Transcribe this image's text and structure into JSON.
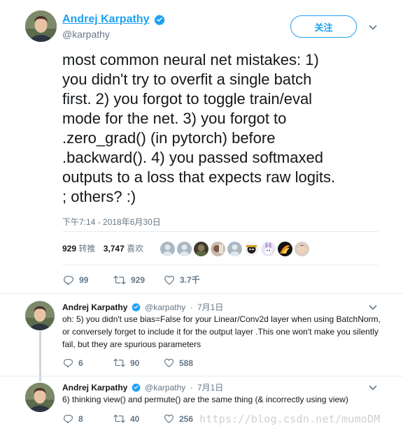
{
  "main_tweet": {
    "author_name": "Andrej Karpathy",
    "author_handle": "@karpathy",
    "follow_label": "关注",
    "text": "most common neural net mistakes: 1)\nyou didn't try to overfit a single batch\nfirst. 2) you forgot to toggle train/eval\nmode for the net. 3) you forgot to\n.zero_grad() (in pytorch) before\n.backward(). 4) you passed softmaxed\noutputs to a loss that expects raw logits.\n; others? :)",
    "timestamp": "下午7:14 - 2018年6月30日",
    "retweet_count": "929",
    "retweet_label": "转推",
    "like_count": "3,747",
    "like_label": "喜欢",
    "actions": {
      "replies": "99",
      "retweets": "929",
      "likes": "3.7千"
    }
  },
  "replies": [
    {
      "author_name": "Andrej Karpathy",
      "author_handle": "@karpathy",
      "date": "7月1日",
      "text": "oh: 5) you didn't use bias=False for your Linear/Conv2d layer when using BatchNorm, or conversely forget to include it for the output layer .This one won't make you silently fail, but they are spurious parameters",
      "actions": {
        "replies": "6",
        "retweets": "90",
        "likes": "588"
      }
    },
    {
      "author_name": "Andrej Karpathy",
      "author_handle": "@karpathy",
      "date": "7月1日",
      "text": "6) thinking view() and permute() are the same thing (& incorrectly using view)",
      "actions": {
        "replies": "8",
        "retweets": "40",
        "likes": "256"
      }
    }
  ],
  "watermark": "https://blog.csdn.net/mumoDM",
  "colors": {
    "accent": "#1da1f2",
    "text": "#14171a",
    "muted": "#657786",
    "divider": "#e6ecf0"
  },
  "icons": [
    "verified-icon",
    "chevron-down-icon",
    "reply-icon",
    "retweet-icon",
    "like-icon"
  ]
}
